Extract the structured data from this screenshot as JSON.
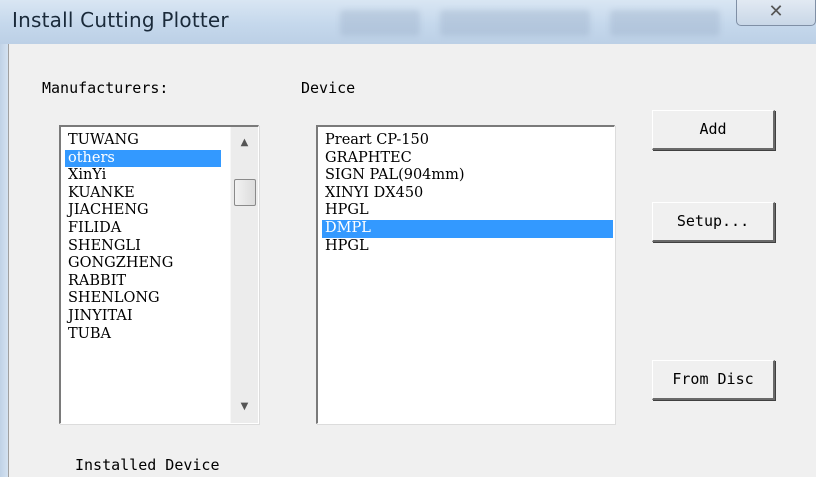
{
  "window": {
    "title": "Install Cutting Plotter",
    "close_icon": "close-icon"
  },
  "labels": {
    "manufacturers": "Manufacturers:",
    "device": "Device",
    "installed_device": "Installed Device"
  },
  "manufacturers": {
    "items": [
      "TUWANG",
      "others",
      "XinYi",
      "KUANKE",
      "JIACHENG",
      "FILIDA",
      "SHENGLI",
      "GONGZHENG",
      "RABBIT",
      "SHENLONG",
      "JINYITAI",
      "TUBA"
    ],
    "selected": "others",
    "scroll_up_icon": "scroll-up-icon",
    "scroll_down_icon": "scroll-down-icon"
  },
  "devices": {
    "items": [
      "Preart CP-150",
      "GRAPHTEC",
      "SIGN PAL(904mm)",
      "XINYI DX450",
      "HPGL",
      "DMPL",
      "HPGL"
    ],
    "selected": "DMPL"
  },
  "buttons": {
    "add": "Add",
    "setup": "Setup...",
    "from_disc": "From Disc"
  },
  "colors": {
    "selection": "#3399ff",
    "dialog_bg": "#f0f0f0"
  }
}
